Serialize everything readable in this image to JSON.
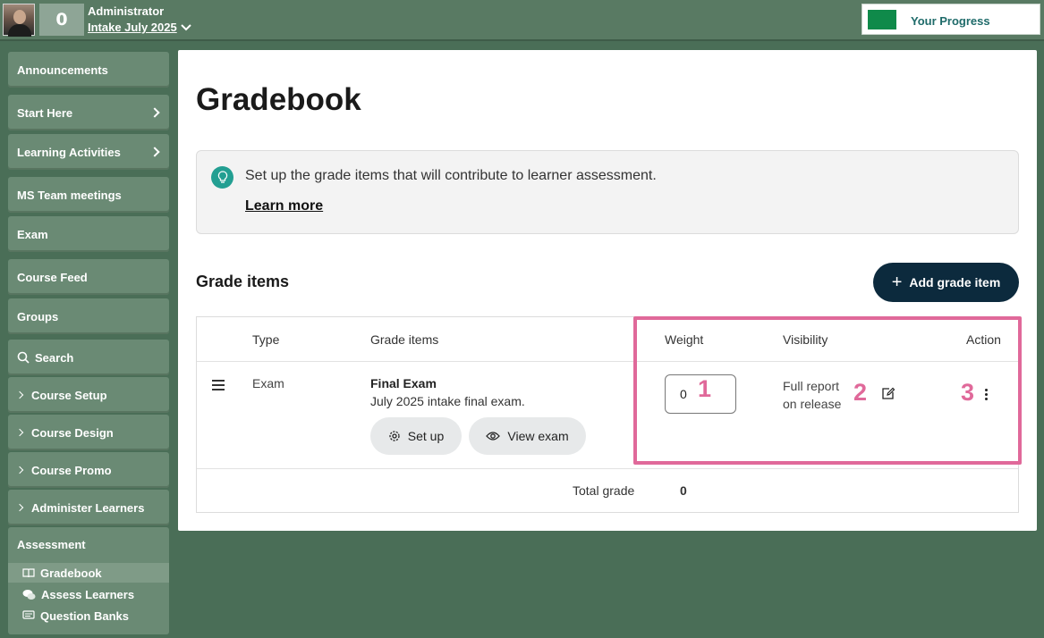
{
  "header": {
    "points": "0",
    "role": "Administrator",
    "intake": "Intake July 2025",
    "progress_label": "Your Progress",
    "progress_color": "#0f8a4a"
  },
  "sidebar": {
    "items": [
      {
        "label": "Announcements"
      },
      {
        "label": "Start Here"
      },
      {
        "label": "Learning Activities"
      },
      {
        "label": "MS Team meetings"
      },
      {
        "label": "Exam"
      },
      {
        "label": "Course Feed"
      },
      {
        "label": "Groups"
      },
      {
        "label": "Search"
      },
      {
        "label": "Course Setup"
      },
      {
        "label": "Course Design"
      },
      {
        "label": "Course Promo"
      },
      {
        "label": "Administer Learners"
      }
    ],
    "assessment": {
      "label": "Assessment",
      "children": [
        {
          "label": "Gradebook"
        },
        {
          "label": "Assess Learners"
        },
        {
          "label": "Question Banks"
        }
      ]
    }
  },
  "main": {
    "title": "Gradebook",
    "info_message": "Set up the grade items that will contribute to learner assessment.",
    "learn_more": "Learn more",
    "section_title": "Grade items",
    "add_button": "Add grade item",
    "table": {
      "headers": [
        "Type",
        "Grade items",
        "Weight",
        "Visibility",
        "Action"
      ],
      "rows": [
        {
          "type": "Exam",
          "name": "Final Exam",
          "description": "July 2025 intake final exam.",
          "setup_label": "Set up",
          "view_label": "View exam",
          "weight": "0",
          "visibility_line1": "Full report",
          "visibility_line2": "on release"
        }
      ],
      "total_label": "Total grade",
      "total_value": "0"
    }
  },
  "annotations": {
    "one": "1",
    "two": "2",
    "three": "3",
    "color": "#e0699a"
  }
}
